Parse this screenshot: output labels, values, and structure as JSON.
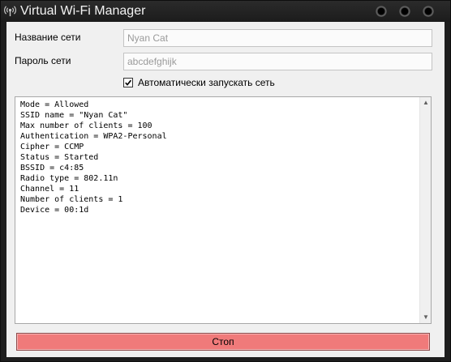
{
  "window": {
    "title": "Virtual Wi-Fi Manager"
  },
  "form": {
    "network_name_label": "Название сети",
    "network_name_value": "Nyan Cat",
    "password_label": "Пароль сети",
    "password_value": "abcdefghijk",
    "autostart_label": "Автоматически запускать сеть",
    "autostart_checked": true
  },
  "log": {
    "lines": [
      "Mode = Allowed",
      "SSID name = \"Nyan Cat\"",
      "Max number of clients = 100",
      "Authentication = WPA2-Personal",
      "Cipher = CCMP",
      "Status = Started",
      "BSSID = c4:85",
      "Radio type = 802.11n",
      "Channel = 11",
      "Number of clients = 1",
      "Device = 00:1d"
    ]
  },
  "actions": {
    "stop_label": "Стоп"
  },
  "colors": {
    "stop_button": "#f07a7a",
    "titlebar": "#1c1c1c",
    "client_bg": "#f0f0f0"
  }
}
